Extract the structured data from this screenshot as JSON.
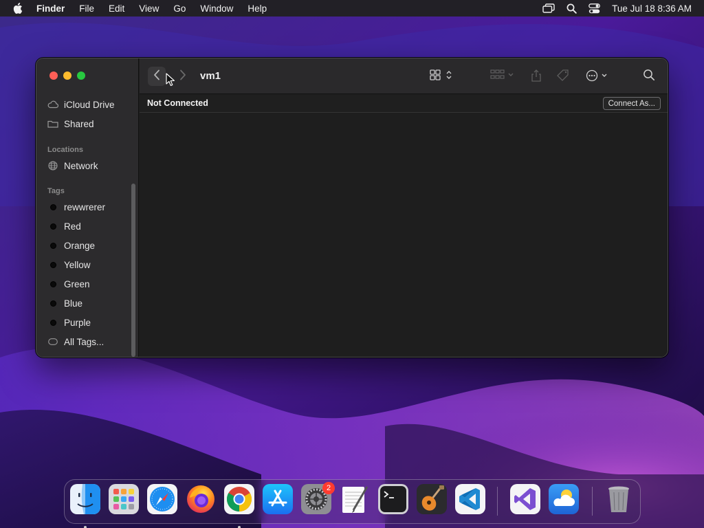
{
  "menubar": {
    "app_name": "Finder",
    "menus": [
      "File",
      "Edit",
      "View",
      "Go",
      "Window",
      "Help"
    ],
    "clock": "Tue Jul 18  8:36 AM",
    "status_icons": [
      "screen-mirroring-icon",
      "spotlight-search-icon",
      "control-center-icon"
    ]
  },
  "window": {
    "title": "vm1",
    "sidebar": {
      "favorites": [
        {
          "label": "iCloud Drive",
          "icon": "cloud-icon"
        },
        {
          "label": "Shared",
          "icon": "shared-folder-icon"
        }
      ],
      "locations_header": "Locations",
      "locations": [
        {
          "label": "Network",
          "icon": "globe-icon"
        }
      ],
      "tags_header": "Tags",
      "tags": [
        "rewwrerer",
        "Red",
        "Orange",
        "Yellow",
        "Green",
        "Blue",
        "Purple"
      ],
      "all_tags_label": "All Tags..."
    },
    "status_text": "Not Connected",
    "connect_button": "Connect As..."
  },
  "dock": {
    "apps": [
      {
        "name": "Finder",
        "running": true
      },
      {
        "name": "Launchpad",
        "running": false
      },
      {
        "name": "Safari",
        "running": false
      },
      {
        "name": "Firefox",
        "running": false
      },
      {
        "name": "Google Chrome",
        "running": true
      },
      {
        "name": "App Store",
        "running": false
      },
      {
        "name": "System Settings",
        "running": false,
        "badge": "2"
      },
      {
        "name": "TextEdit",
        "running": false
      },
      {
        "name": "Terminal",
        "running": false
      },
      {
        "name": "GarageBand",
        "running": false
      },
      {
        "name": "Visual Studio Code",
        "running": false
      },
      {
        "name": "Visual Studio",
        "running": false
      },
      {
        "name": "Weather",
        "running": false
      },
      {
        "name": "Trash",
        "running": false
      }
    ]
  },
  "colors": {
    "close": "#fe5f57",
    "minimize": "#febc2e",
    "maximize": "#28c840",
    "badge": "#ff3b30"
  }
}
